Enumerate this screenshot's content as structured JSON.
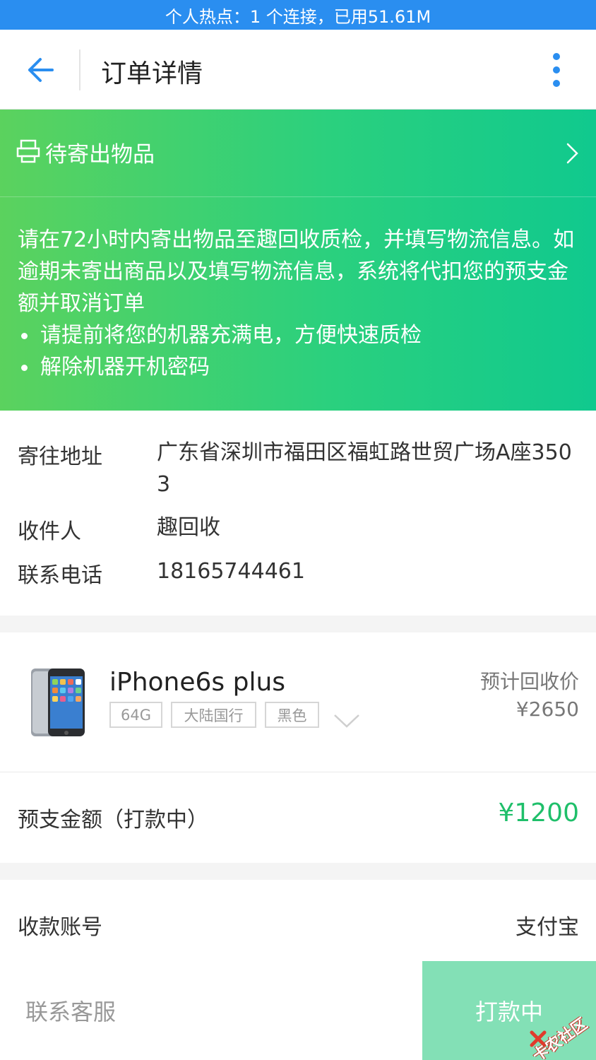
{
  "status_bar": {
    "text": "个人热点：1 个连接，已用51.61M"
  },
  "app_bar": {
    "title": "订单详情",
    "back_icon": "arrow-left-icon",
    "more_icon": "more-vertical-icon"
  },
  "colors": {
    "accent": "#2a8ef0",
    "green_start": "#5bd25e",
    "green_end": "#10c98e",
    "amount_green": "#1fbf6a",
    "pay_button": "#83e0b6"
  },
  "pending": {
    "label": "待寄出物品",
    "notice_main": "请在72小时内寄出物品至趣回收质检，并填写物流信息。如逾期未寄出商品以及填写物流信息，系统将代扣您的预支金额并取消订单",
    "bullets": [
      "请提前将您的机器充满电，方便快速质检",
      "解除机器开机密码"
    ]
  },
  "shipping": {
    "address_label": "寄往地址",
    "address_value": "广东省深圳市福田区福虹路世贸广场A座3503",
    "recipient_label": "收件人",
    "recipient_value": "趣回收",
    "phone_label": "联系电话",
    "phone_value": "18165744461"
  },
  "product": {
    "name": "iPhone6s plus",
    "tags": [
      "64G",
      "大陆国行",
      "黑色"
    ],
    "estimate_label": "预计回收价",
    "estimate_value": "¥2650"
  },
  "prepay": {
    "label": "预支金额（打款中）",
    "amount": "¥1200"
  },
  "account": {
    "label": "收款账号",
    "value": "支付宝"
  },
  "bottom": {
    "contact_label": "联系客服",
    "pay_label": "打款中",
    "watermark": "卡农社区"
  }
}
